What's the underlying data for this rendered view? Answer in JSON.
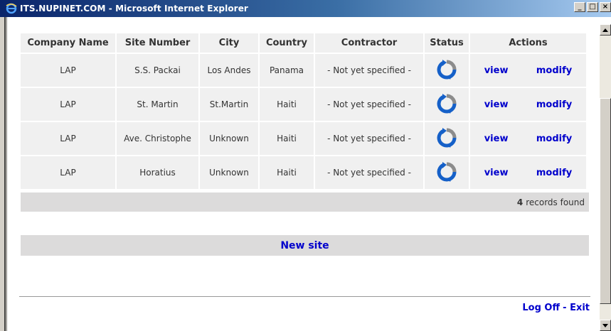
{
  "window": {
    "title": "ITS.NUPINET.COM - Microsoft Internet Explorer",
    "buttons": {
      "minimize": "_",
      "maximize": "□",
      "close": "×"
    }
  },
  "table": {
    "headers": [
      "Company Name",
      "Site Number",
      "City",
      "Country",
      "Contractor",
      "Status",
      "Actions"
    ],
    "rows": [
      {
        "company": "LAP",
        "site": "S.S. Packai",
        "city": "Los Andes",
        "country": "Panama",
        "contractor": "- Not yet specified -",
        "status_icon": "refresh-icon",
        "view": "view",
        "modify": "modify"
      },
      {
        "company": "LAP",
        "site": "St. Martin",
        "city": "St.Martin",
        "country": "Haiti",
        "contractor": "- Not yet specified -",
        "status_icon": "refresh-icon",
        "view": "view",
        "modify": "modify"
      },
      {
        "company": "LAP",
        "site": "Ave. Christophe",
        "city": "Unknown",
        "country": "Haiti",
        "contractor": "- Not yet specified -",
        "status_icon": "refresh-icon",
        "view": "view",
        "modify": "modify"
      },
      {
        "company": "LAP",
        "site": "Horatius",
        "city": "Unknown",
        "country": "Haiti",
        "contractor": "- Not yet specified -",
        "status_icon": "refresh-icon",
        "view": "view",
        "modify": "modify"
      }
    ]
  },
  "records": {
    "count": "4",
    "label": "records found"
  },
  "new_site": "New site",
  "footer": {
    "logoff": "Log Off",
    "sep": "-",
    "exit": "Exit"
  },
  "colors": {
    "link": "#0000cc",
    "cell_bg": "#f0f0f0",
    "bar_bg": "#dcdbdb",
    "titlebar": "#0a246a"
  }
}
